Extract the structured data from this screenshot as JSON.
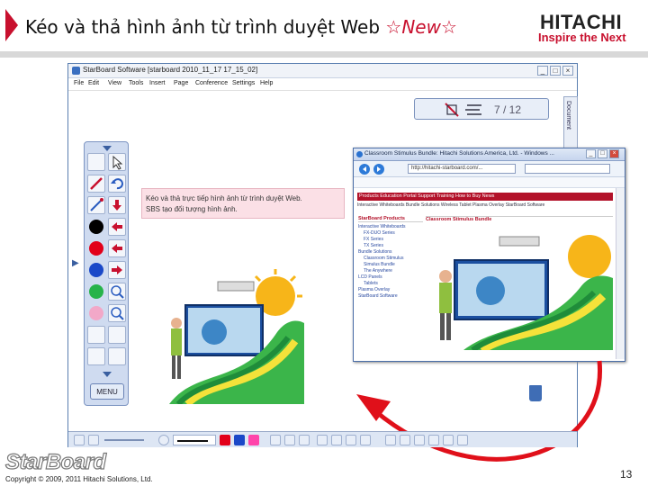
{
  "slide": {
    "title": "Kéo và thả hình ảnh từ trình duyệt Web",
    "badge": "☆New☆",
    "page_number": "13",
    "copyright": "Copyright © 2009, 2011 Hitachi Solutions, Ltd."
  },
  "brand": {
    "logo": "HITACHI",
    "tagline": "Inspire the Next",
    "product_logo": "StarBoard",
    "accent_color": "#c8102e"
  },
  "app": {
    "window_title": "StarBoard Software [starboard 2010_11_17 17_15_02]",
    "menu": [
      "File",
      "Edit",
      "View",
      "Tools",
      "Insert",
      "Page",
      "Conference",
      "Settings",
      "Help"
    ],
    "page_indicator": "7 / 12",
    "document_tab": "Document",
    "palette_menu_label": "MENU"
  },
  "annotation": {
    "line1": "Kéo và thả trực tiếp hình ảnh từ trình duyệt Web.",
    "line2": "SBS tạo đối tượng hình ảnh."
  },
  "browser": {
    "title": "Classroom Stimulus Bundle: Hitachi Solutions America, Ltd. - Windows ...",
    "address": "http://hitachi-starboard.com/...",
    "nav_items": "Products   Education Portal   Support   Training   How to Buy   News",
    "sub_nav": "Interactive Whiteboards   Bundle Solutions   Wireless Tablet   Plasma Overlay   StarBoard Software",
    "sidebar_heading": "StarBoard Products",
    "sidebar_items": [
      "Interactive Whiteboards",
      "FX-DUO Series",
      "FX Series",
      "TX Series",
      "Bundle Solutions",
      "Classroom Stimulus",
      "Simulus Bundle",
      "The Anywhere",
      "LCD Panels",
      "Tablets",
      "Plasma Overlay",
      "StarBoard Software"
    ],
    "main_heading": "Classroom Stimulus Bundle"
  },
  "icons": [
    "back-icon",
    "forward-icon",
    "trash-icon",
    "pen-icon",
    "eraser-icon",
    "undo-icon"
  ]
}
